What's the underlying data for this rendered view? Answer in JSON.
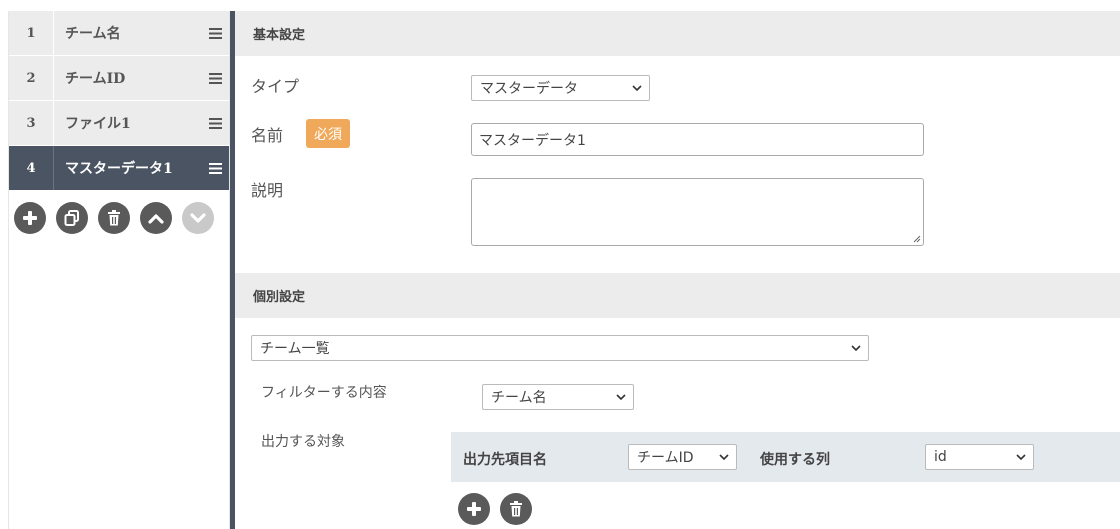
{
  "steps": [
    {
      "number": "1",
      "label": "チーム名"
    },
    {
      "number": "2",
      "label": "チームID"
    },
    {
      "number": "3",
      "label": "ファイル1"
    },
    {
      "number": "4",
      "label": "マスターデータ1"
    }
  ],
  "active_step": "4",
  "step_actions": [
    "add-icon",
    "copy-icon",
    "trash-icon",
    "chevron-up-icon",
    "chevron-down-icon"
  ],
  "basic": {
    "header": "基本設定",
    "type_label": "タイプ",
    "type_value": "マスターデータ",
    "name_label": "名前",
    "required_badge": "必須",
    "name_value": "マスターデータ1",
    "description_label": "説明",
    "description_value": ""
  },
  "individual": {
    "header": "個別設定",
    "source_value": "チーム一覧",
    "filter_label": "フィルターする内容",
    "filter_value": "チーム名",
    "output_label": "出力する対象",
    "output_header": {
      "target_item_label": "出力先項目名",
      "target_item_value": "チームID",
      "column_label": "使用する列",
      "column_value": "id"
    }
  },
  "colors": {
    "active_step": "#4a5462",
    "badge": "#f0a85a",
    "header_bg": "#ececec",
    "output_header_bg": "#e4e9ee"
  }
}
